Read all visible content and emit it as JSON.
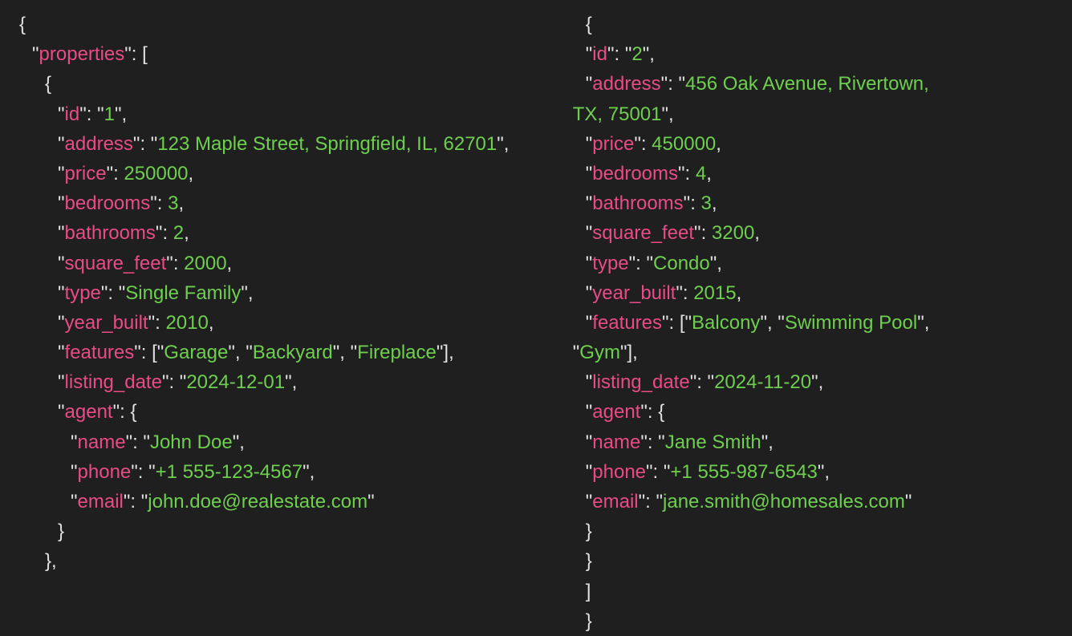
{
  "col1": {
    "l0": {
      "p": "{"
    },
    "l1": {
      "k": "properties",
      "p1": "\"",
      "p2": "\": ["
    },
    "l2": {
      "p": "{"
    },
    "l3": {
      "k": "id",
      "v": "1",
      "p1": "\"",
      "p2": "\": \"",
      "p3": "\","
    },
    "l4": {
      "k": "address",
      "v": "123 Maple Street, Springfield, IL, 62701",
      "p1": "\"",
      "p2": "\": \"",
      "p3": "\","
    },
    "l5": {
      "k": "price",
      "n": "250000",
      "p1": "\"",
      "p2": "\": ",
      "p3": ","
    },
    "l6": {
      "k": "bedrooms",
      "n": "3",
      "p1": "\"",
      "p2": "\": ",
      "p3": ","
    },
    "l7": {
      "k": "bathrooms",
      "n": "2",
      "p1": "\"",
      "p2": "\": ",
      "p3": ","
    },
    "l8": {
      "k": "square_feet",
      "n": "2000",
      "p1": "\"",
      "p2": "\": ",
      "p3": ","
    },
    "l9": {
      "k": "type",
      "v": "Single Family",
      "p1": "\"",
      "p2": "\": \"",
      "p3": "\","
    },
    "l10": {
      "k": "year_built",
      "n": "2010",
      "p1": "\"",
      "p2": "\": ",
      "p3": ","
    },
    "l11": {
      "k": "features",
      "a0": "Garage",
      "a1": "Backyard",
      "a2": "Fireplace",
      "p1": "\"",
      "p2": "\": [\"",
      "c": "\", \"",
      "p3": "\"],"
    },
    "l12": {
      "k": "listing_date",
      "v": "2024-12-01",
      "p1": "\"",
      "p2": "\": \"",
      "p3": "\","
    },
    "l13": {
      "k": "agent",
      "p1": "\"",
      "p2": "\": {"
    },
    "l14": {
      "k": "name",
      "v": "John Doe",
      "p1": "\"",
      "p2": "\": \"",
      "p3": "\","
    },
    "l15": {
      "k": "phone",
      "v": "+1 555-123-4567",
      "p1": "\"",
      "p2": "\": \"",
      "p3": "\","
    },
    "l16": {
      "k": "email",
      "v": "john.doe@realestate.com",
      "p1": "\"",
      "p2": "\": \"",
      "p3": "\""
    },
    "l17": {
      "p": "}"
    },
    "l18": {
      "p": "},"
    }
  },
  "col2": {
    "l0": {
      "p": "{"
    },
    "l1": {
      "k": "id",
      "v": "2",
      "p1": "\"",
      "p2": "\": \"",
      "p3": "\","
    },
    "l2a": {
      "k": "address",
      "v": "456 Oak Avenue, Rivertown,",
      "p1": "\"",
      "p2": "\": \""
    },
    "l2b": {
      "v": "TX, 75001",
      "p3": "\","
    },
    "l3": {
      "k": "price",
      "n": "450000",
      "p1": "\"",
      "p2": "\": ",
      "p3": ","
    },
    "l4": {
      "k": "bedrooms",
      "n": "4",
      "p1": "\"",
      "p2": "\": ",
      "p3": ","
    },
    "l5": {
      "k": "bathrooms",
      "n": "3",
      "p1": "\"",
      "p2": "\": ",
      "p3": ","
    },
    "l6": {
      "k": "square_feet",
      "n": "3200",
      "p1": "\"",
      "p2": "\": ",
      "p3": ","
    },
    "l7": {
      "k": "type",
      "v": "Condo",
      "p1": "\"",
      "p2": "\": \"",
      "p3": "\","
    },
    "l8": {
      "k": "year_built",
      "n": "2015",
      "p1": "\"",
      "p2": "\": ",
      "p3": ","
    },
    "l9a": {
      "k": "features",
      "a0": "Balcony",
      "a1": "Swimming Pool",
      "p1": "\"",
      "p2": "\": [\"",
      "c": "\", \"",
      "tail": "\","
    },
    "l9b": {
      "a0": "Gym",
      "p1": "\"",
      "p3": "\"],"
    },
    "l10": {
      "k": "listing_date",
      "v": "2024-11-20",
      "p1": "\"",
      "p2": "\": \"",
      "p3": "\","
    },
    "l11": {
      "k": "agent",
      "p1": "\"",
      "p2": "\": {"
    },
    "l12": {
      "k": "name",
      "v": "Jane Smith",
      "p1": "\"",
      "p2": "\": \"",
      "p3": "\","
    },
    "l13": {
      "k": "phone",
      "v": "+1 555-987-6543",
      "p1": "\"",
      "p2": "\": \"",
      "p3": "\","
    },
    "l14": {
      "k": "email",
      "v": "jane.smith@homesales.com",
      "p1": "\"",
      "p2": "\": \"",
      "p3": "\""
    },
    "l15": {
      "p": "}"
    },
    "l16": {
      "p": "}"
    },
    "l17": {
      "p": "]"
    },
    "l18": {
      "p": "}"
    }
  }
}
